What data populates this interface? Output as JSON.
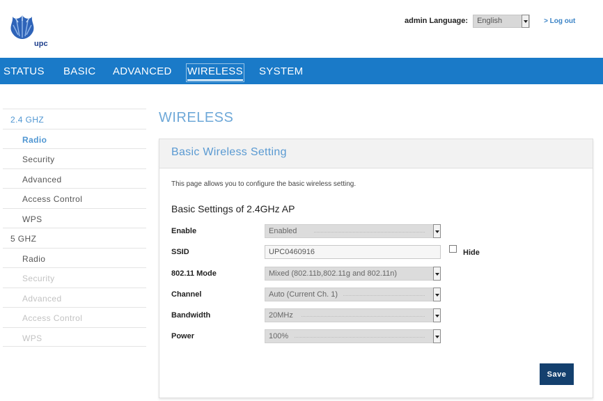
{
  "header": {
    "logo_text": "upc",
    "admin_label": "admin Language:",
    "language": "English",
    "logout": "> Log out"
  },
  "nav": {
    "items": [
      "STATUS",
      "BASIC",
      "ADVANCED",
      "WIRELESS",
      "SYSTEM"
    ],
    "active": "WIRELESS"
  },
  "sidebar": {
    "items": [
      "2.4 GHZ",
      "Radio",
      "Security",
      "Advanced",
      "Access Control",
      "WPS",
      "5 GHZ",
      "Radio",
      "Security",
      "Advanced",
      "Access Control",
      "WPS"
    ]
  },
  "main": {
    "page_title": "WIRELESS",
    "panel_title": "Basic Wireless Setting",
    "description": "This page allows you to configure the basic wireless setting.",
    "section_title": "Basic Settings of 2.4GHz AP",
    "fields": {
      "enable": {
        "label": "Enable",
        "value": "Enabled"
      },
      "ssid": {
        "label": "SSID",
        "value": "UPC0460916",
        "hide_label": "Hide"
      },
      "mode": {
        "label": "802.11 Mode",
        "value": "Mixed (802.11b,802.11g and 802.11n)"
      },
      "channel": {
        "label": "Channel",
        "value": "Auto (Current Ch. 1)"
      },
      "bandwidth": {
        "label": "Bandwidth",
        "value": "20MHz"
      },
      "power": {
        "label": "Power",
        "value": "100%"
      }
    },
    "save_label": "Save"
  },
  "colors": {
    "nav_bg": "#1a7ac8",
    "accent": "#4f96d2",
    "button": "#14406e"
  }
}
